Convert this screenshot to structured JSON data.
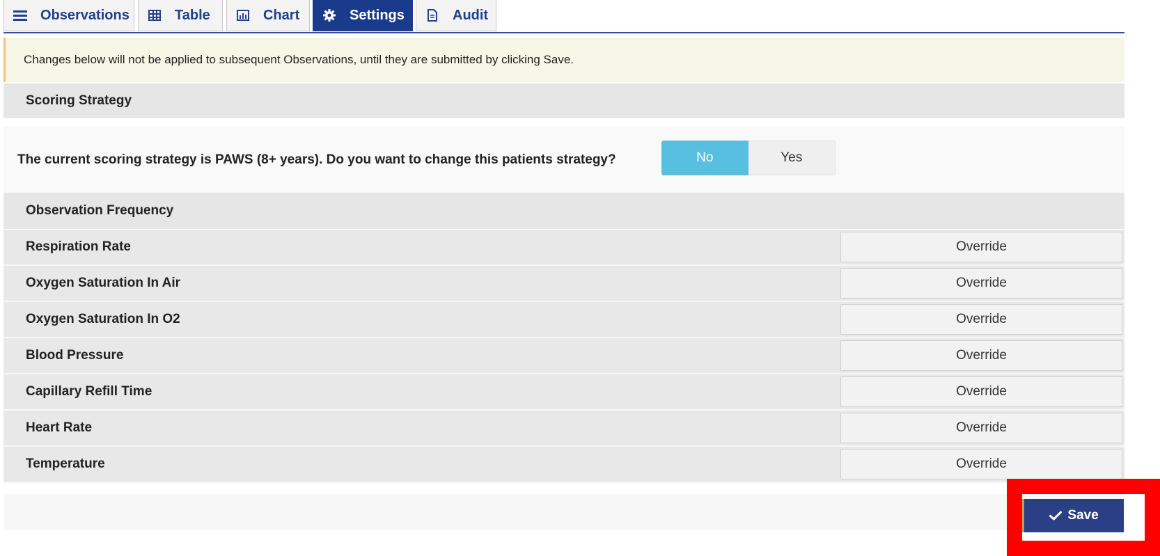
{
  "tabs": [
    {
      "label": "Observations",
      "icon": "list-icon"
    },
    {
      "label": "Table",
      "icon": "table-icon"
    },
    {
      "label": "Chart",
      "icon": "bar-chart-icon"
    },
    {
      "label": "Settings",
      "icon": "gear-icon",
      "active": true
    },
    {
      "label": "Audit",
      "icon": "document-icon"
    }
  ],
  "banner": {
    "text": "Changes below will not be applied to subsequent Observations, until they are submitted by clicking Save.",
    "border_color": "#f0c27a",
    "background": "#f7f7e7"
  },
  "scoring": {
    "header": "Scoring Strategy",
    "question": "The current scoring strategy is PAWS (8+ years). Do you want to change this patients strategy?",
    "toggle": {
      "no_label": "No",
      "yes_label": "Yes",
      "selected": "No"
    }
  },
  "frequency": {
    "header": "Observation Frequency",
    "rows": [
      {
        "label": "Respiration Rate",
        "action": "Override"
      },
      {
        "label": "Oxygen Saturation In Air",
        "action": "Override"
      },
      {
        "label": "Oxygen Saturation In O2",
        "action": "Override"
      },
      {
        "label": "Blood Pressure",
        "action": "Override"
      },
      {
        "label": "Capillary Refill Time",
        "action": "Override"
      },
      {
        "label": "Heart Rate",
        "action": "Override"
      },
      {
        "label": "Temperature",
        "action": "Override"
      }
    ]
  },
  "footer": {
    "save_label": "Save",
    "save_icon": "check-icon"
  },
  "colors": {
    "tab_active_bg": "#1a3a8c",
    "tab_text": "#1f3f8f",
    "toggle_selected": "#59bfe0",
    "save_bg": "#2b3f86",
    "highlight": "#ff0000"
  }
}
